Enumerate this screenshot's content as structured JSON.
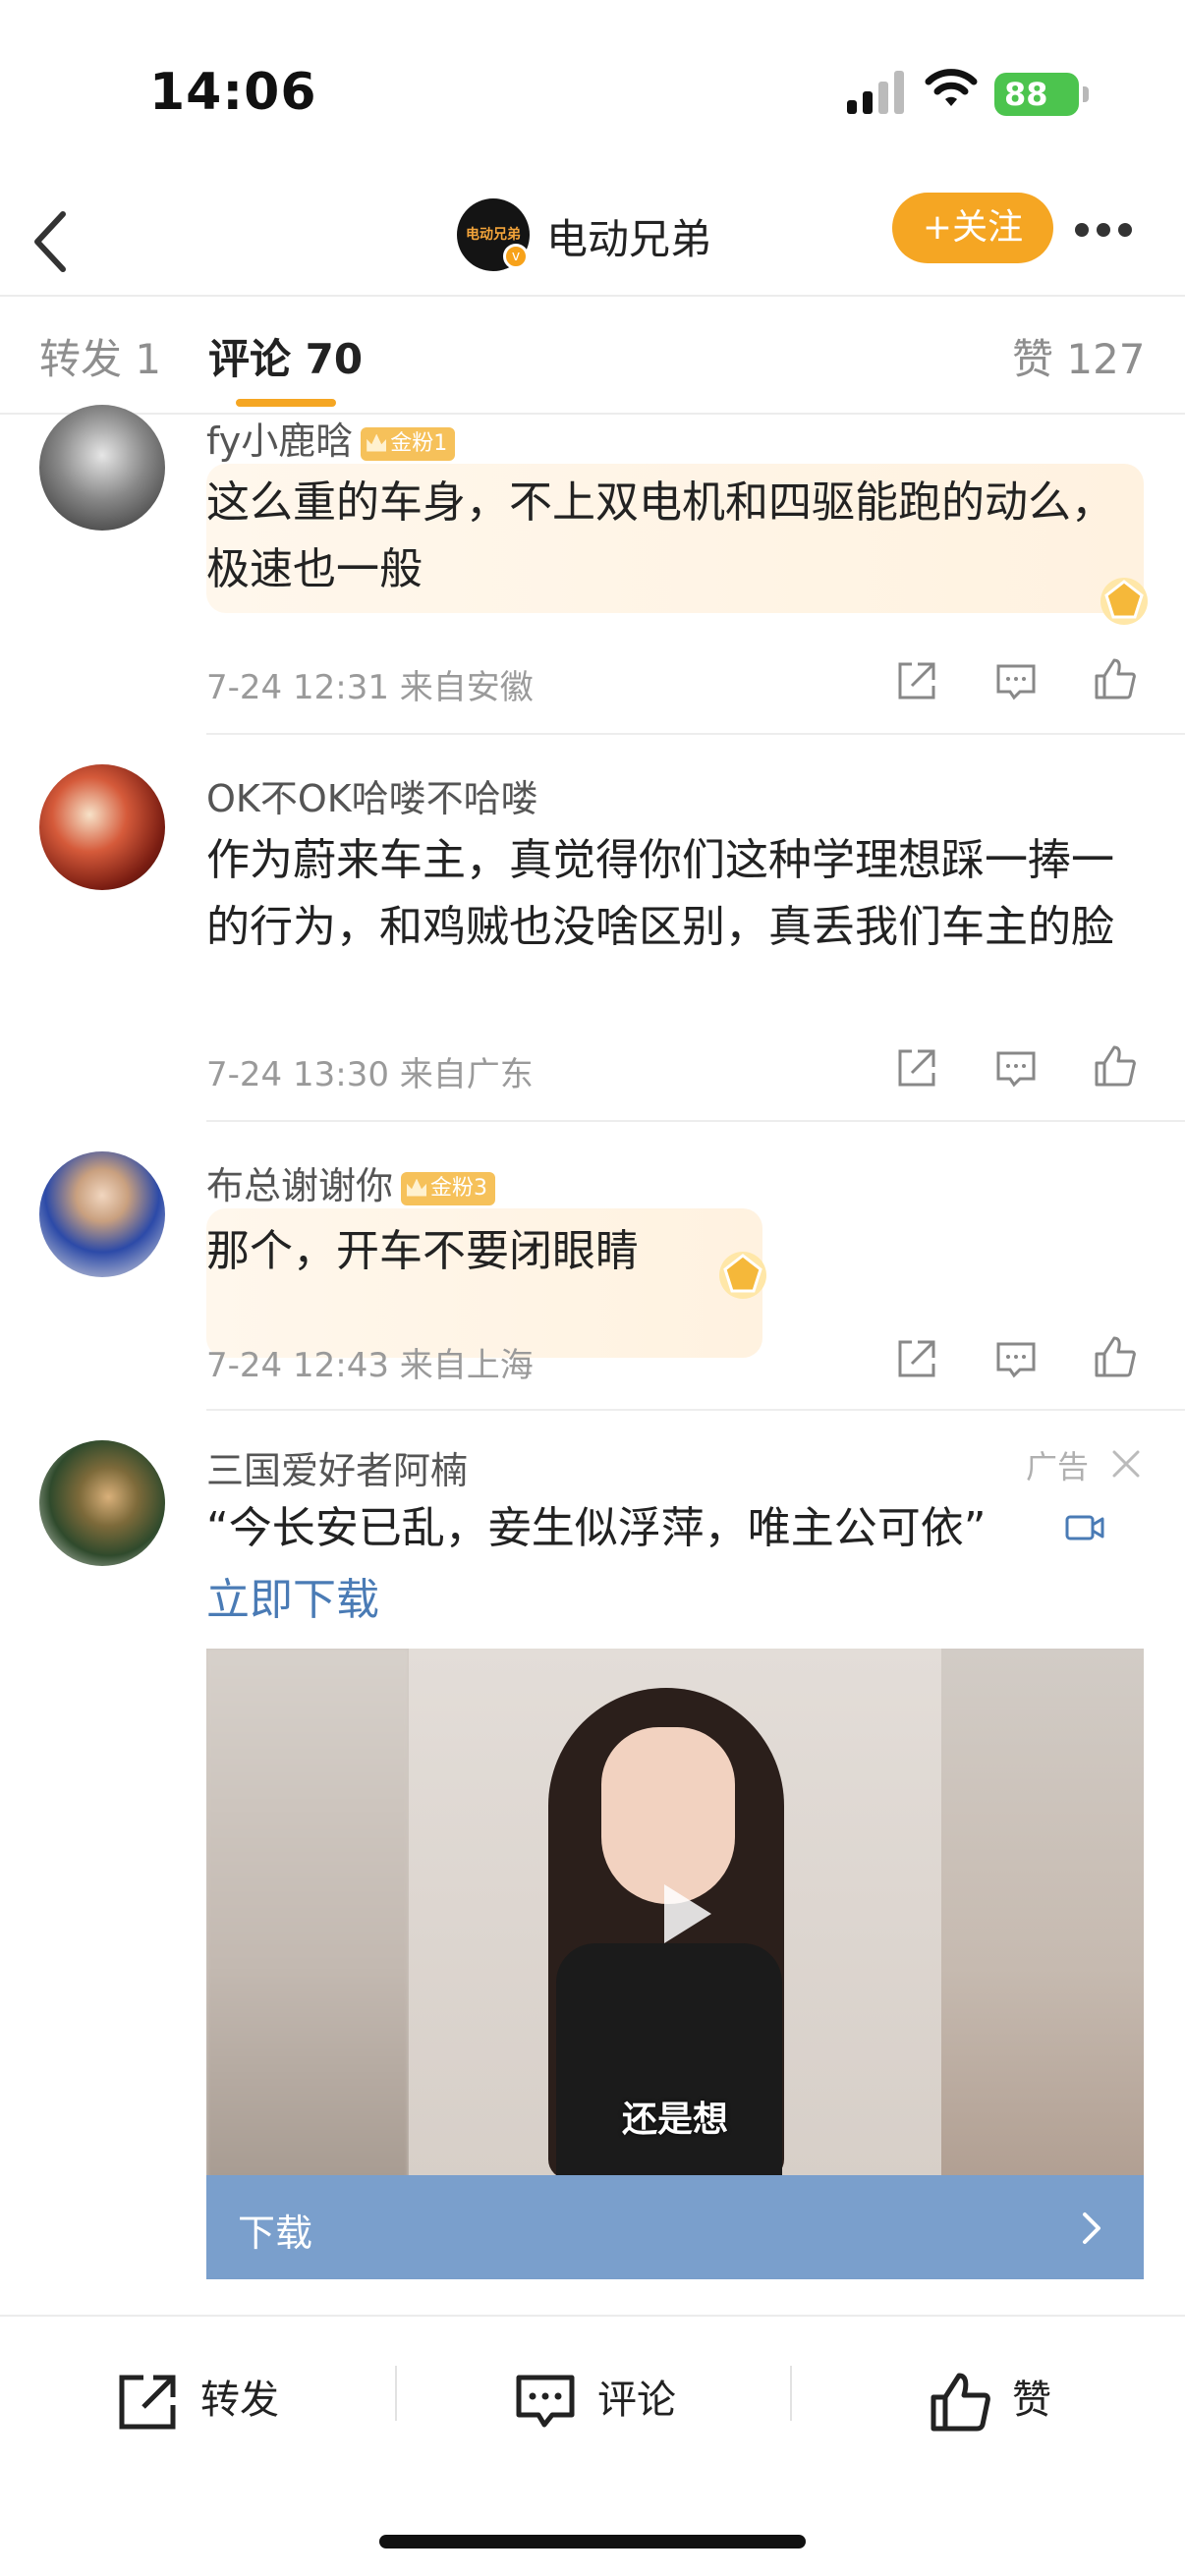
{
  "status_bar": {
    "time": "14:06",
    "battery": "88"
  },
  "header": {
    "avatar_text": "电动兄弟",
    "title": "电动兄弟",
    "follow_label": "+关注"
  },
  "tabs": [
    {
      "label": "转发 1"
    },
    {
      "label": "评论 70"
    },
    {
      "label": "赞 127"
    }
  ],
  "comments": [
    {
      "name": "fy小鹿晗",
      "badge": "金粉1",
      "text": "这么重的车身，不上双电机和四驱能跑的动么，极速也一般",
      "meta": "7-24 12:31 来自安徽"
    },
    {
      "name": "OK不OK哈喽不哈喽",
      "text": "作为蔚来车主，真觉得你们这种学理想踩一捧一的行为，和鸡贼也没啥区别，真丢我们车主的脸",
      "meta": "7-24 13:30 来自广东"
    },
    {
      "name": "布总谢谢你",
      "badge": "金粉3",
      "text": "那个，开车不要闭眼睛",
      "meta": "7-24 12:43 来自上海"
    }
  ],
  "ad": {
    "name": "三国爱好者阿楠",
    "label": "广告",
    "text": "“今长安已乱，妾生似浮萍，唯主公可依”",
    "link": "立即下载",
    "video_caption": "还是想",
    "download_label": "下载"
  },
  "bottom_bar": {
    "repost": "转发",
    "comment": "评论",
    "like": "赞"
  },
  "colors": {
    "accent": "#f5a623",
    "link": "#4a7bb5",
    "download_bar": "#7a9fcc"
  },
  "icons": [
    "back-arrow-icon",
    "more-icon",
    "share-icon",
    "comment-icon",
    "like-icon",
    "video-icon",
    "play-icon",
    "close-icon",
    "chevron-right-icon"
  ]
}
